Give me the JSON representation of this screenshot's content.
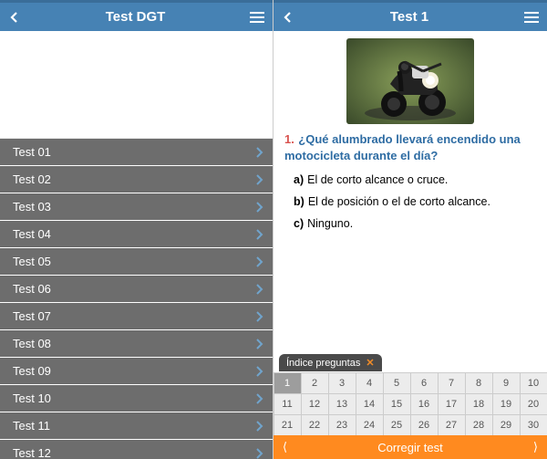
{
  "left": {
    "header": {
      "title": "Test DGT"
    },
    "tests": [
      {
        "label": "Test 01"
      },
      {
        "label": "Test 02"
      },
      {
        "label": "Test 03"
      },
      {
        "label": "Test 04"
      },
      {
        "label": "Test 05"
      },
      {
        "label": "Test 06"
      },
      {
        "label": "Test 07"
      },
      {
        "label": "Test 08"
      },
      {
        "label": "Test 09"
      },
      {
        "label": "Test 10"
      },
      {
        "label": "Test 11"
      },
      {
        "label": "Test 12"
      }
    ]
  },
  "right": {
    "header": {
      "title": "Test 1"
    },
    "question": {
      "number": "1.",
      "text": "¿Qué alumbrado llevará encendido una motocicleta durante el día?",
      "answers": [
        {
          "letter": "a)",
          "text": "El de corto alcance o cruce."
        },
        {
          "letter": "b)",
          "text": "El de posición o el de corto alcance."
        },
        {
          "letter": "c)",
          "text": "Ninguno."
        }
      ]
    },
    "index": {
      "tab_label": "Índice preguntas",
      "close_glyph": "✕",
      "count": 30,
      "selected": 1,
      "correct_label": "Corregir test",
      "prev_glyph": "⟨",
      "next_glyph": "⟩"
    }
  }
}
